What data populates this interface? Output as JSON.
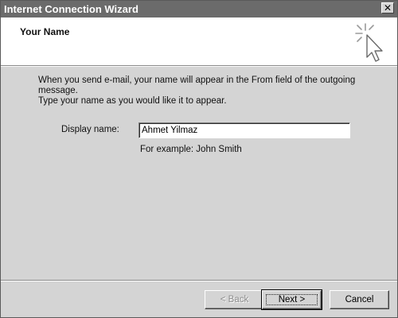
{
  "window": {
    "title": "Internet Connection Wizard",
    "close_glyph": "✕"
  },
  "header": {
    "title": "Your Name",
    "icon": "wizard-cursor-icon"
  },
  "body": {
    "instructions_line1": "When you send e-mail, your name will appear in the From field of the outgoing message.",
    "instructions_line2": "Type your name as you would like it to appear."
  },
  "form": {
    "display_name_label": "Display name:",
    "display_name_value": "Ahmet Yilmaz",
    "example": "For example: John Smith"
  },
  "buttons": {
    "back_label": "< Back",
    "next_label": "Next >",
    "cancel_label": "Cancel",
    "back_enabled": false
  },
  "colors": {
    "titlebar": "#6b6b6b",
    "dialog_bg": "#d4d4d4",
    "header_bg": "#ffffff"
  }
}
